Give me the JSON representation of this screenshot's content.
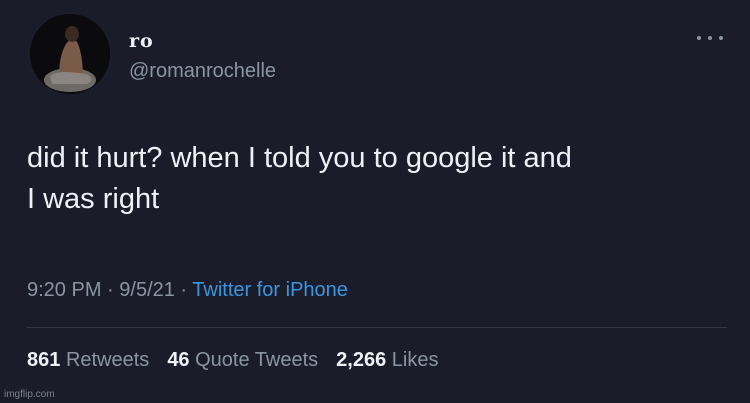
{
  "user": {
    "display_name": "ro",
    "handle": "@romanrochelle"
  },
  "tweet": {
    "text_line1": "did it hurt? when I told you to google it and",
    "text_line2": "I was right"
  },
  "meta": {
    "time": "9:20 PM",
    "separator": " · ",
    "date": "9/5/21",
    "source": "Twitter for iPhone"
  },
  "stats": {
    "retweets_count": "861",
    "retweets_label": "Retweets",
    "quotes_count": "46",
    "quotes_label": "Quote Tweets",
    "likes_count": "2,266",
    "likes_label": "Likes"
  },
  "watermark": "imgflip.com",
  "icons": {
    "more": "more-horizontal-icon",
    "avatar": "profile-photo"
  },
  "colors": {
    "background": "#1a1d29",
    "primary_text": "#eef1f6",
    "secondary_text": "#8a94a3",
    "link": "#3b95e0"
  }
}
